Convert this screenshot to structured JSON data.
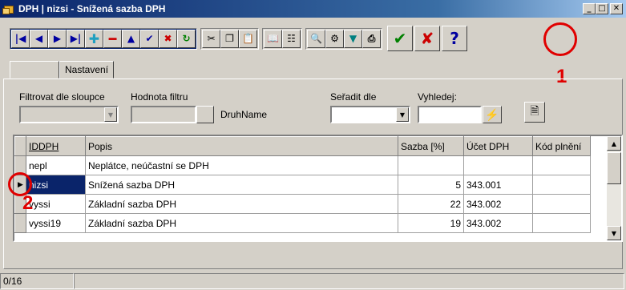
{
  "window": {
    "title": "DPH | nizsi - Snížená sazba DPH",
    "controls": [
      "minimize",
      "maximize",
      "close"
    ]
  },
  "toolbar": {
    "nav_buttons": [
      "first-record",
      "prior-record",
      "next-record",
      "last-record",
      "insert-record",
      "delete-record",
      "edit-record",
      "post-record",
      "cancel-record",
      "refresh-record"
    ],
    "tool_buttons": [
      "cut",
      "copy",
      "paste",
      "book",
      "tree",
      "search",
      "settings",
      "filter",
      "print"
    ],
    "confirm_button": "confirm",
    "cancel_button": "cancel",
    "help_button": "help",
    "colors": {
      "accent": "#0a246a",
      "confirm": "#008000",
      "cancel": "#cc0000"
    }
  },
  "annotations": {
    "marker_1": "1",
    "marker_2": "2",
    "color": "#e00000"
  },
  "tabs": [
    {
      "label": ""
    },
    {
      "label": "Nastavení"
    }
  ],
  "filters": {
    "filter_column_label": "Filtrovat dle sloupce",
    "filter_value_label": "Hodnota filtru",
    "filter_field_name": "DruhName",
    "sort_label": "Seřadit dle",
    "search_label": "Vyhledej:"
  },
  "grid": {
    "columns": [
      "IDDPH",
      "Popis",
      "Sazba [%]",
      "Účet DPH",
      "Kód plnění"
    ],
    "rows": [
      {
        "id": "nepl",
        "popis": "Neplátce, neúčastní se DPH",
        "sazba": "",
        "ucet": "",
        "kod": ""
      },
      {
        "id": "nizsi",
        "popis": "Snížená sazba DPH",
        "sazba": "5",
        "ucet": "343.001",
        "kod": "",
        "selected": true
      },
      {
        "id": "vyssi",
        "popis": "Základní sazba DPH",
        "sazba": "22",
        "ucet": "343.002",
        "kod": ""
      },
      {
        "id": "vyssi19",
        "popis": "Základní sazba DPH",
        "sazba": "19",
        "ucet": "343.002",
        "kod": ""
      }
    ]
  },
  "status": {
    "record_counter": "0/16"
  }
}
